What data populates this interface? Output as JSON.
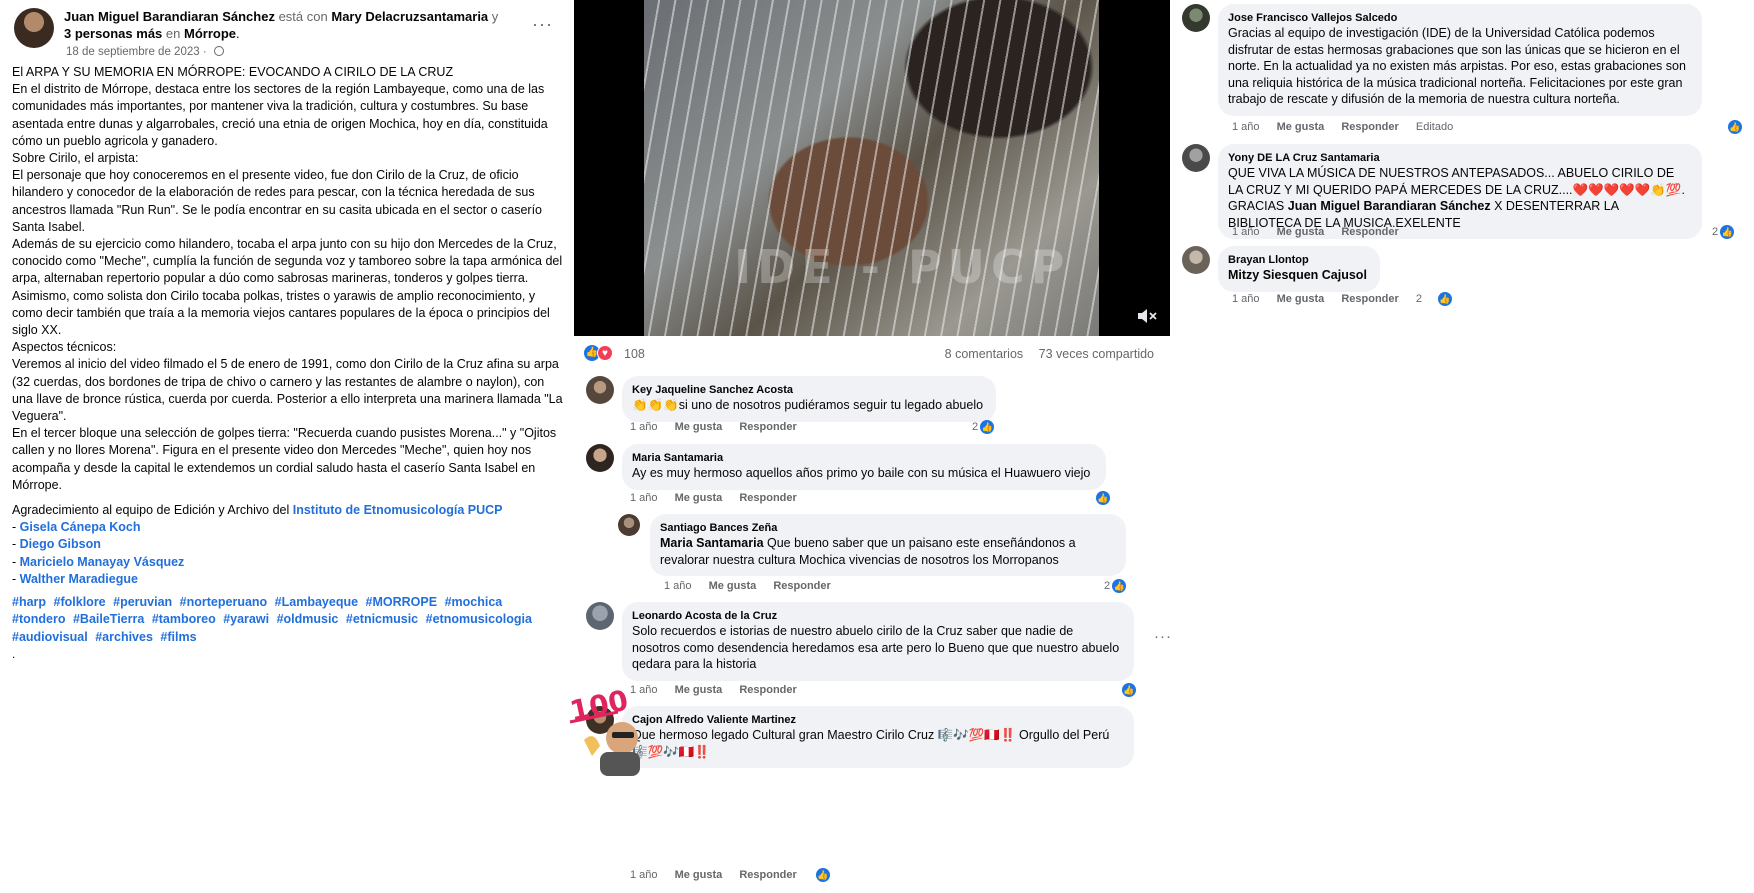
{
  "post": {
    "author": "Juan Miguel Barandiaran Sánchez",
    "with_word": "está con",
    "tagged": "Mary Delacruzsantamaria",
    "and_word": "y",
    "others": "3 personas más",
    "in_word": "en",
    "place": "Mórrope",
    "date": "18 de septiembre de 2023",
    "more_icon": "···",
    "body_paragraphs": [
      "El ARPA Y SU MEMORIA EN MÓRROPE: EVOCANDO A CIRILO DE LA CRUZ\nEn el distrito de Mórrope, destaca entre los sectores de la región Lambayeque, como una de las comunidades más importantes, por mantener viva la tradición, cultura y costumbres. Su base asentada entre dunas y algarrobales, creció una etnia de origen Mochica, hoy en día, constituida cómo un pueblo agricola y ganadero.\nSobre Cirilo, el arpista:\nEl personaje que hoy conoceremos en el presente video, fue don Cirilo de la Cruz, de oficio hilandero y conocedor de la elaboración de redes para pescar, con la técnica heredada de sus ancestros llamada \"Run Run\". Se le podía encontrar en su casita ubicada en el sector o caserío Santa Isabel.\nAdemás de su ejercicio como hilandero, tocaba el arpa junto con su hijo don Mercedes de la Cruz, conocido como \"Meche\", cumplía la función de segunda voz y tamboreo sobre la tapa armónica del arpa, alternaban repertorio popular a dúo como sabrosas marineras, tonderos y golpes tierra.\nAsimismo, como solista don Cirilo tocaba polkas, tristes o yarawis de amplio reconocimiento, y como decir también que traía a la memoria viejos cantares populares de la época o principios del siglo XX.\nAspectos técnicos:\nVeremos al inicio del video filmado el 5 de enero de 1991, como don Cirilo de la Cruz afina su arpa (32 cuerdas, dos bordones de tripa de chivo o carnero y las restantes de alambre o naylon), con una llave de bronce rústica, cuerda por cuerda. Posterior a ello interpreta una marinera llamada \"La Veguera\".\nEn el tercer bloque una selección de golpes tierra: \"Recuerda cuando pusistes Morena...\" y \"Ojitos callen y no llores Morena\". Figura en el presente video don Mercedes \"Meche\", quien hoy nos acompaña y desde la capital le extendemos un cordial saludo hasta el caserío Santa Isabel en Mórrope."
    ],
    "thanks_prefix": "Agradecimiento al equipo de Edición y Archivo del",
    "institute_link": "Instituto de Etnomusicología PUCP",
    "collaborators": [
      "Gisela Cánepa Koch",
      "Diego Gibson",
      "Maricielo Manayay Vásquez",
      "Walther Maradiegue"
    ],
    "hashtags": [
      "#harp",
      "#folklore",
      "#peruvian",
      "#norteperuano",
      "#Lambayeque",
      "#MORROPE",
      "#mochica",
      "#tondero",
      "#BaileTierra",
      "#tamboreo",
      "#yarawi",
      "#oldmusic",
      "#etnicmusic",
      "#etnomusicologia",
      "#audiovisual",
      "#archives",
      "#films"
    ],
    "trailing_dot": "."
  },
  "video": {
    "watermark": "IDE - PUCP",
    "mute_icon": "speaker-muted-icon"
  },
  "stats": {
    "reactions_count": "108",
    "comments": "8 comentarios",
    "shares": "73 veces compartido"
  },
  "actions": {
    "time": "1 año",
    "like": "Me gusta",
    "reply": "Responder",
    "edited": "Editado"
  },
  "comments": [
    {
      "name": "Key Jaqueline Sanchez Acosta",
      "text": "👏👏👏si uno de nosotros pudiéramos seguir tu legado abuelo",
      "reactions": "2"
    },
    {
      "name": "Maria Santamaria",
      "text": "Ay es muy hermoso aquellos años primo yo baile con su música el Huawuero viejo",
      "reactions": ""
    },
    {
      "name": "Santiago Bances Zeña",
      "mention": "Maria Santamaria",
      "text": " Que bueno saber que un paisano este enseñándonos a revalorar nuestra cultura Mochica vivencias de nosotros los Morropanos",
      "reactions": "2"
    },
    {
      "name": "Leonardo Acosta de la Cruz",
      "text": "Solo recuerdos e istorias de nuestro abuelo cirilo de la Cruz saber que nadie de nosotros como desendencia heredamos esa arte pero lo Bueno que que nuestro abuelo qedara para la historia",
      "reactions": ""
    },
    {
      "name": "Cajon Alfredo Valiente Martinez",
      "text": "Que hermoso legado Cultural gran Maestro Cirilo Cruz 🎼🎶💯🇵🇪‼️ Orgullo del Perú 🎼💯🎶🇵🇪‼️",
      "reactions": ""
    }
  ],
  "right_comments": [
    {
      "name": "Jose Francisco Vallejos Salcedo",
      "text": "Gracias al equipo de investigación (IDE) de la Universidad Católica podemos disfrutar de estas hermosas grabaciones que son las únicas que se hicieron en el norte. En la actualidad ya no existen más arpistas. Por eso, estas grabaciones son una reliquia histórica de la música tradicional norteña. Felicitaciones por este gran trabajo de rescate y difusión de la memoria de nuestra cultura norteña.",
      "reactions": ""
    },
    {
      "name": "Yony DE LA Cruz Santamaria",
      "text": "QUE VIVA LA MÚSICA DE NUESTROS ANTEPASADOS... ABUELO CIRILO DE LA CRUZ Y MI QUERIDO PAPÁ MERCEDES DE LA CRUZ....❤️❤️❤️❤️❤️👏💯. GRACIAS",
      "mention": "Juan Miguel Barandiaran Sánchez",
      "text_after": " X DESENTERRAR LA BIBLIOTECA DE LA MUSICA.EXELENTE",
      "reactions": "2"
    },
    {
      "name": "Brayan Llontop",
      "mention": "Mitzy Siesquen Cajusol",
      "reactions": "2"
    }
  ],
  "colors": {
    "link": "#216fdb",
    "like": "#1b74e4",
    "love": "#f33e58",
    "bubble": "#f0f2f5",
    "muted": "#65676b"
  }
}
